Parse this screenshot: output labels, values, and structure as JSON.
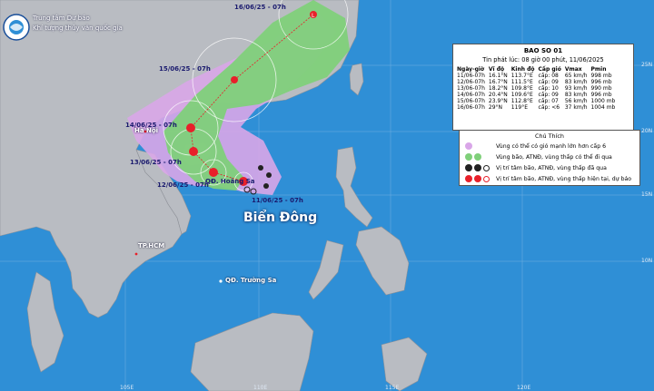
{
  "agency": {
    "line1": "Trung tâm Dự báo",
    "line2": "Khí tượng thủy văn quốc gia"
  },
  "info_box": {
    "title": "BAO SO 01",
    "issued": "Tin phát lúc: 08 giờ 00 phút, 11/06/2025",
    "headers": [
      "Ngày-giờ",
      "Vĩ độ",
      "Kinh độ",
      "Cấp gió",
      "Vmax",
      "Pmin"
    ],
    "rows": [
      [
        "11/06-07h",
        "16.1°N",
        "113.7°E",
        "cấp: 08",
        "65 km/h",
        "998 mb"
      ],
      [
        "12/06-07h",
        "16.7°N",
        "111.5°E",
        "cấp: 09",
        "83 km/h",
        "996 mb"
      ],
      [
        "13/06-07h",
        "18.2°N",
        "109.8°E",
        "cấp: 10",
        "93 km/h",
        "990 mb"
      ],
      [
        "14/06-07h",
        "20.4°N",
        "109.6°E",
        "cấp: 09",
        "83 km/h",
        "996 mb"
      ],
      [
        "15/06-07h",
        "23.9°N",
        "112.8°E",
        "cấp: 07",
        "56 km/h",
        "1000 mb"
      ],
      [
        "16/06-07h",
        "29°N",
        "119°E",
        "cấp: <6",
        "37 km/h",
        "1004 mb"
      ]
    ]
  },
  "legend": {
    "title": "Chú Thích",
    "items": [
      {
        "text": "Vùng có thể có gió mạnh lớn hơn cấp 6",
        "color": "#d9a6e8"
      },
      {
        "text": "Vùng bão, ATNĐ, vùng thấp có thể đi qua",
        "color": "#7fd07a"
      },
      {
        "text": "Vị trí tâm bão, ATNĐ, vùng thấp đã qua",
        "color": "#222222"
      },
      {
        "text": "Vị trí tâm bão, ATNĐ, vùng thấp hiện tại, dự báo",
        "color": "#e8202a"
      }
    ]
  },
  "dates": {
    "d16": "16/06/25 - 07h",
    "d15": "15/06/25 - 07h",
    "d14": "14/06/25 - 07h",
    "d13": "13/06/25 - 07h",
    "d12": "12/06/25 - 07h",
    "d11": "11/06/25 - 07h"
  },
  "places": {
    "hanoi": "Hà Nội",
    "hcm": "TP.HCM",
    "hoangsa": "QĐ. Hoàng Sa",
    "truongsa": "QĐ. Trường Sa",
    "sea": "Biển Đông"
  },
  "grid": {
    "lat": [
      "25N",
      "20N",
      "15N",
      "10N"
    ],
    "lon": [
      "105E",
      "110E",
      "115E",
      "120E"
    ]
  },
  "colors": {
    "sea": "#2f8fd6",
    "land": "#b9bcc2",
    "wind_zone": "#d9a6e8",
    "track_zone": "#7fd07a",
    "current": "#e8202a",
    "past": "#222222"
  }
}
